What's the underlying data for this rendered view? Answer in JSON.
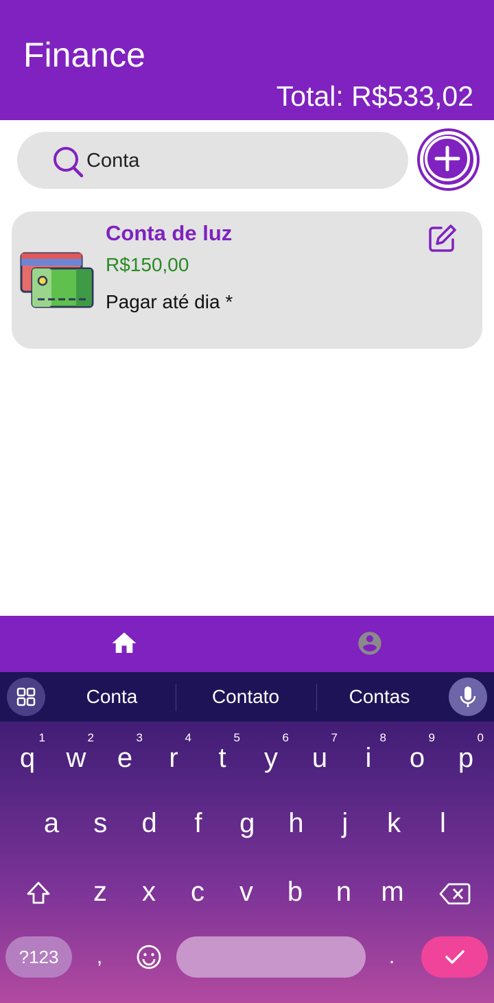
{
  "header": {
    "title": "Finance",
    "total": "Total: R$533,02"
  },
  "search": {
    "value": "Conta",
    "icon": "search-icon"
  },
  "add_button": {
    "icon": "plus-circle-icon"
  },
  "items": [
    {
      "name": "Conta de luz",
      "amount": "R$150,00",
      "note": "Pagar até dia *",
      "icon": "credit-cards-icon",
      "edit_icon": "edit-icon"
    }
  ],
  "nav": {
    "home_icon": "home-icon",
    "profile_icon": "account-circle-icon"
  },
  "keyboard": {
    "suggestions": [
      "Conta",
      "Contato",
      "Contas"
    ],
    "row1": [
      {
        "k": "q",
        "n": "1"
      },
      {
        "k": "w",
        "n": "2"
      },
      {
        "k": "e",
        "n": "3"
      },
      {
        "k": "r",
        "n": "4"
      },
      {
        "k": "t",
        "n": "5"
      },
      {
        "k": "y",
        "n": "6"
      },
      {
        "k": "u",
        "n": "7"
      },
      {
        "k": "i",
        "n": "8"
      },
      {
        "k": "o",
        "n": "9"
      },
      {
        "k": "p",
        "n": "0"
      }
    ],
    "row2": [
      "a",
      "s",
      "d",
      "f",
      "g",
      "h",
      "j",
      "k",
      "l"
    ],
    "row3": [
      "z",
      "x",
      "c",
      "v",
      "b",
      "n",
      "m"
    ],
    "symbols_label": "?123",
    "comma": ",",
    "period": ".",
    "colors": {
      "accent": "#7f22bf",
      "enter": "#f0449a"
    }
  }
}
